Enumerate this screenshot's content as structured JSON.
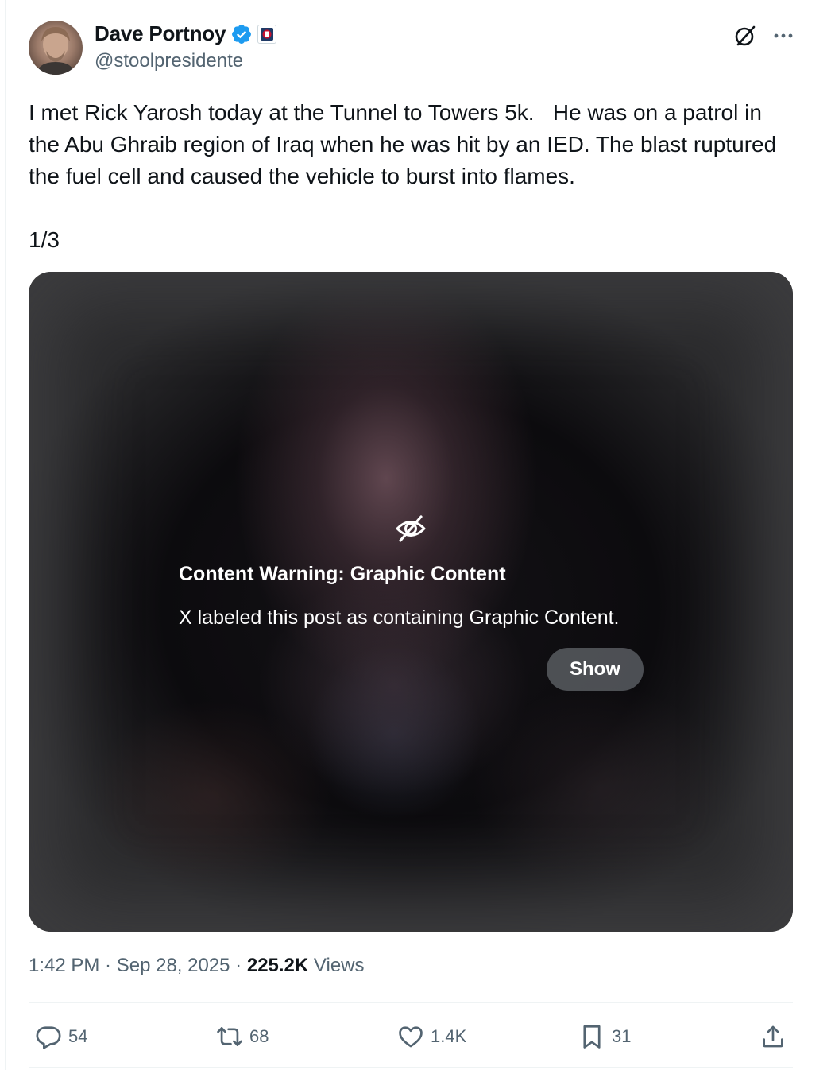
{
  "post": {
    "author": {
      "display_name": "Dave Portnoy",
      "handle": "@stoolpresidente",
      "verified_color": "#1d9bf0"
    },
    "icons": {
      "grok": "grok-icon",
      "more": "more-icon"
    },
    "text": "I met Rick Yarosh today at the Tunnel to Towers 5k.   He was on a patrol in the Abu Ghraib region of Iraq when he was hit by an IED. The blast ruptured the fuel cell and caused the vehicle to burst into flames.\n\n1/3",
    "media": {
      "warning_title": "Content Warning: Graphic Content",
      "warning_description": "X labeled this post as containing Graphic Content.",
      "show_label": "Show"
    },
    "meta": {
      "time": "1:42 PM",
      "separator": " · ",
      "date": "Sep 28, 2025",
      "views_count": "225.2K",
      "views_label": "Views"
    },
    "actions": {
      "replies": "54",
      "reposts": "68",
      "likes": "1.4K",
      "bookmarks": "31"
    }
  }
}
